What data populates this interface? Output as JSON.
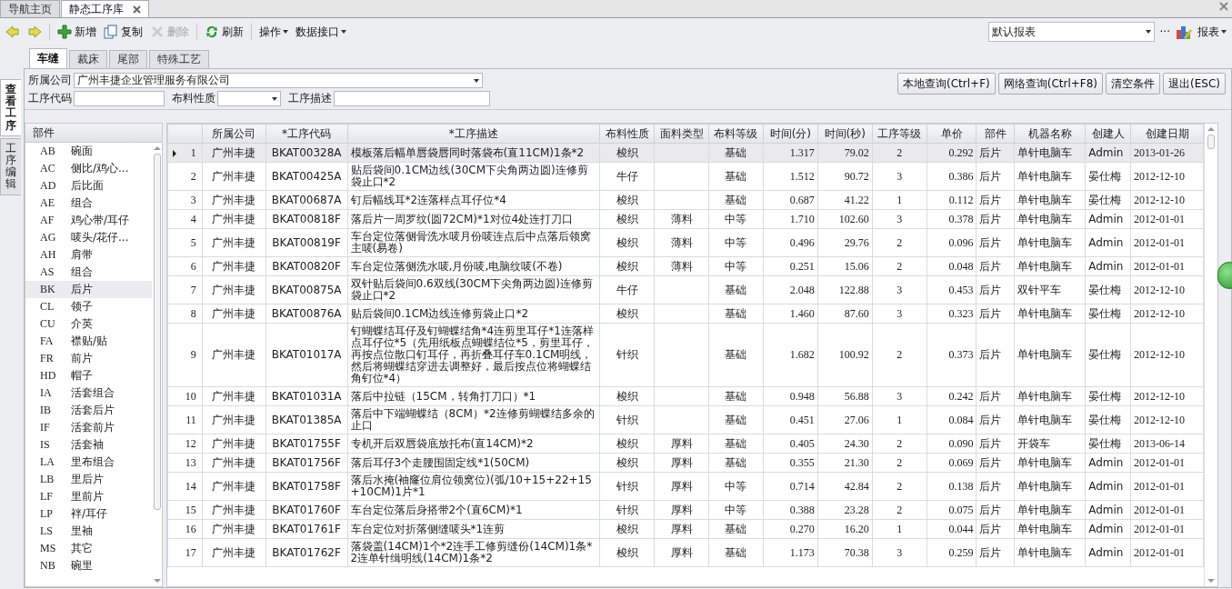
{
  "doc_tabs": [
    {
      "label": "导航主页",
      "selected": false,
      "closable": false
    },
    {
      "label": "静态工序库",
      "selected": true,
      "closable": true
    }
  ],
  "toolbar": {
    "buttons": [
      {
        "kind": "back",
        "disabled": false
      },
      {
        "kind": "forward",
        "disabled": false
      },
      {
        "kind": "add",
        "label": "新增",
        "disabled": false
      },
      {
        "kind": "copy",
        "label": "复制",
        "disabled": false
      },
      {
        "kind": "delete",
        "label": "删除",
        "disabled": true
      },
      {
        "kind": "refresh",
        "label": "刷新",
        "disabled": false
      }
    ],
    "menus": [
      "操作",
      "数据接口"
    ],
    "report_select": {
      "value": "默认报表",
      "more": "···"
    },
    "report_menu": "报表"
  },
  "sub_tabs": [
    {
      "label": "车缝",
      "selected": true
    },
    {
      "label": "裁床",
      "selected": false
    },
    {
      "label": "尾部",
      "selected": false
    },
    {
      "label": "特殊工艺",
      "selected": false
    }
  ],
  "side_tabs": [
    {
      "label": "查看工序",
      "selected": true
    },
    {
      "label": "工序编辑",
      "selected": false
    }
  ],
  "filter": {
    "fields": [
      {
        "kind": "combo",
        "label": "所属公司",
        "value": "广州丰捷企业管理服务有限公司"
      },
      {
        "kind": "text",
        "label": "工序代码"
      },
      {
        "kind": "combo",
        "label": "布料性质"
      },
      {
        "kind": "text",
        "label": "工序描述"
      }
    ],
    "buttons": [
      "本地查询(Ctrl+F)",
      "网络查询(Ctrl+F8)",
      "清空条件",
      "退出(ESC)"
    ]
  },
  "parts": {
    "title": "部件",
    "items": [
      {
        "code": "AB",
        "name": "碗面",
        "selected": false
      },
      {
        "code": "AC",
        "name": "侧比/鸡心...",
        "selected": false
      },
      {
        "code": "AD",
        "name": "后比面",
        "selected": false
      },
      {
        "code": "AE",
        "name": "组合",
        "selected": false
      },
      {
        "code": "AF",
        "name": "鸡心带/耳仔",
        "selected": false
      },
      {
        "code": "AG",
        "name": "唛头/花仔...",
        "selected": false
      },
      {
        "code": "AH",
        "name": "肩带",
        "selected": false
      },
      {
        "code": "AS",
        "name": "组合",
        "selected": false
      },
      {
        "code": "BK",
        "name": "后片",
        "selected": true
      },
      {
        "code": "CL",
        "name": "领子",
        "selected": false
      },
      {
        "code": "CU",
        "name": "介英",
        "selected": false
      },
      {
        "code": "FA",
        "name": "襟贴/贴",
        "selected": false
      },
      {
        "code": "FR",
        "name": "前片",
        "selected": false
      },
      {
        "code": "HD",
        "name": "帽子",
        "selected": false
      },
      {
        "code": "IA",
        "name": "活套组合",
        "selected": false
      },
      {
        "code": "IB",
        "name": "活套后片",
        "selected": false
      },
      {
        "code": "IF",
        "name": "活套前片",
        "selected": false
      },
      {
        "code": "IS",
        "name": "活套袖",
        "selected": false
      },
      {
        "code": "LA",
        "name": "里布组合",
        "selected": false
      },
      {
        "code": "LB",
        "name": "里后片",
        "selected": false
      },
      {
        "code": "LF",
        "name": "里前片",
        "selected": false
      },
      {
        "code": "LP",
        "name": "袢/耳仔",
        "selected": false
      },
      {
        "code": "LS",
        "name": "里袖",
        "selected": false
      },
      {
        "code": "MS",
        "name": "其它",
        "selected": false
      },
      {
        "code": "NB",
        "name": "碗里",
        "selected": false
      }
    ]
  },
  "grid": {
    "columns": [
      "所属公司",
      "*工序代码",
      "*工序描述",
      "布料性质",
      "面料类型",
      "布料等级",
      "时间(分)",
      "时间(秒)",
      "工序等级",
      "单价",
      "部件",
      "机器名称",
      "创建人",
      "创建日期"
    ],
    "rows": [
      {
        "no": "1",
        "selected": true,
        "cells": [
          "广州丰捷",
          "BKAT00328A",
          "模板落后幅单唇袋唇同时落袋布(直11CM)1条*2",
          "梭织",
          null,
          "基础",
          "1.317",
          "79.02",
          "2",
          "0.292",
          "后片",
          "单针电脑车",
          "Admin",
          "2013-01-26"
        ]
      },
      {
        "no": "2",
        "selected": false,
        "cells": [
          "广州丰捷",
          "BKAT00425A",
          "贴后袋间0.1CM边线(30CM下尖角两边圆)连修剪袋止口*2",
          "牛仔",
          null,
          "基础",
          "1.512",
          "90.72",
          "3",
          "0.386",
          "后片",
          "单针电脑车",
          "晏仕梅",
          "2012-12-10"
        ]
      },
      {
        "no": "3",
        "selected": false,
        "cells": [
          "广州丰捷",
          "BKAT00687A",
          "钉后幅线耳*2连落样点耳仔位*4",
          "梭织",
          null,
          "基础",
          "0.687",
          "41.22",
          "1",
          "0.112",
          "后片",
          "单针电脑车",
          "晏仕梅",
          "2012-12-10"
        ]
      },
      {
        "no": "4",
        "selected": false,
        "cells": [
          "广州丰捷",
          "BKAT00818F",
          "落后片一周罗纹(圆72CM)*1对位4处连打刀口",
          "梭织",
          "薄料",
          "中等",
          "1.710",
          "102.60",
          "3",
          "0.378",
          "后片",
          "单针电脑车",
          "Admin",
          "2012-01-01"
        ]
      },
      {
        "no": "5",
        "selected": false,
        "cells": [
          "广州丰捷",
          "BKAT00819F",
          "车台定位落侧骨洗水唛月份唛连点后中点落后领窝主唛(易卷)",
          "梭织",
          "薄料",
          "中等",
          "0.496",
          "29.76",
          "2",
          "0.096",
          "后片",
          "单针电脑车",
          "Admin",
          "2012-01-01"
        ]
      },
      {
        "no": "6",
        "selected": false,
        "cells": [
          "广州丰捷",
          "BKAT00820F",
          "车台定位落侧洗水唛,月份唛,电脑纹唛(不卷)",
          "梭织",
          "薄料",
          "中等",
          "0.251",
          "15.06",
          "2",
          "0.048",
          "后片",
          "单针电脑车",
          "Admin",
          "2012-01-01"
        ]
      },
      {
        "no": "7",
        "selected": false,
        "cells": [
          "广州丰捷",
          "BKAT00875A",
          "双针贴后袋间0.6双线(30CM下尖角两边圆)连修剪袋止口*2",
          "牛仔",
          null,
          "基础",
          "2.048",
          "122.88",
          "3",
          "0.453",
          "后片",
          "双针平车",
          "晏仕梅",
          "2012-12-10"
        ]
      },
      {
        "no": "8",
        "selected": false,
        "cells": [
          "广州丰捷",
          "BKAT00876A",
          "贴后袋间0.1CM边线连修剪袋止口*2",
          "梭织",
          null,
          "基础",
          "1.460",
          "87.60",
          "3",
          "0.323",
          "后片",
          "单针电脑车",
          "晏仕梅",
          "2012-12-10"
        ]
      },
      {
        "no": "9",
        "selected": false,
        "cells": [
          "广州丰捷",
          "BKAT01017A",
          "钉蝴蝶结耳仔及钉蝴蝶结角*4连剪里耳仔*1连落样点耳仔位*5（先用纸板点蝴蝶结位*5，剪里耳仔，再按点位散口钉耳仔，再折叠耳仔车0.1CM明线，然后将蝴蝶结穿进去调整好，最后按点位将蝴蝶结角钉位*4）",
          "针织",
          null,
          "基础",
          "1.682",
          "100.92",
          "2",
          "0.373",
          "后片",
          "单针电脑车",
          "晏仕梅",
          "2012-12-10"
        ]
      },
      {
        "no": "10",
        "selected": false,
        "cells": [
          "广州丰捷",
          "BKAT01031A",
          "落后中拉链（15CM，转角打刀口）*1",
          "梭织",
          null,
          "基础",
          "0.948",
          "56.88",
          "3",
          "0.242",
          "后片",
          "单针电脑车",
          "晏仕梅",
          "2012-12-10"
        ]
      },
      {
        "no": "11",
        "selected": false,
        "cells": [
          "广州丰捷",
          "BKAT01385A",
          "落后中下端蝴蝶结（8CM）*2连修剪蝴蝶结多余的止口",
          "针织",
          null,
          "基础",
          "0.451",
          "27.06",
          "1",
          "0.084",
          "后片",
          "单针电脑车",
          "晏仕梅",
          "2012-12-10"
        ]
      },
      {
        "no": "12",
        "selected": false,
        "cells": [
          "广州丰捷",
          "BKAT01755F",
          "专机开后双唇袋底放托布(直14CM)*2",
          "梭织",
          "厚料",
          "基础",
          "0.405",
          "24.30",
          "2",
          "0.090",
          "后片",
          "开袋车",
          "晏仕梅",
          "2013-06-14"
        ]
      },
      {
        "no": "13",
        "selected": false,
        "cells": [
          "广州丰捷",
          "BKAT01756F",
          "落后耳仔3个走腰围固定线*1(50CM)",
          "梭织",
          "厚料",
          "基础",
          "0.355",
          "21.30",
          "2",
          "0.069",
          "后片",
          "单针电脑车",
          "Admin",
          "2012-01-01"
        ]
      },
      {
        "no": "14",
        "selected": false,
        "cells": [
          "广州丰捷",
          "BKAT01758F",
          "落后水掩(袖窿位肩位领窝位)(弧/10+15+22+15+10CM)1片*1",
          "针织",
          "厚料",
          "中等",
          "0.714",
          "42.84",
          "2",
          "0.138",
          "后片",
          "单针电脑车",
          "Admin",
          "2012-01-01"
        ]
      },
      {
        "no": "15",
        "selected": false,
        "cells": [
          "广州丰捷",
          "BKAT01760F",
          "车台定位落后身搭带2个(直6CM)*1",
          "针织",
          "厚料",
          "中等",
          "0.388",
          "23.28",
          "2",
          "0.075",
          "后片",
          "单针电脑车",
          "Admin",
          "2012-01-01"
        ]
      },
      {
        "no": "16",
        "selected": false,
        "cells": [
          "广州丰捷",
          "BKAT01761F",
          "车台定位对折落侧缝唛头*1连剪",
          "梭织",
          "厚料",
          "基础",
          "0.270",
          "16.20",
          "1",
          "0.044",
          "后片",
          "单针电脑车",
          "Admin",
          "2012-01-01"
        ]
      },
      {
        "no": "17",
        "selected": false,
        "cells": [
          "广州丰捷",
          "BKAT01762F",
          "落袋盖(14CM)1个*2连手工修剪缝份(14CM)1条*2连单针缉明线(14CM)1条*2",
          "梭织",
          "厚料",
          "基础",
          "1.173",
          "70.38",
          "3",
          "0.259",
          "后片",
          "单针电脑车",
          "Admin",
          "2012-01-01"
        ]
      }
    ]
  }
}
